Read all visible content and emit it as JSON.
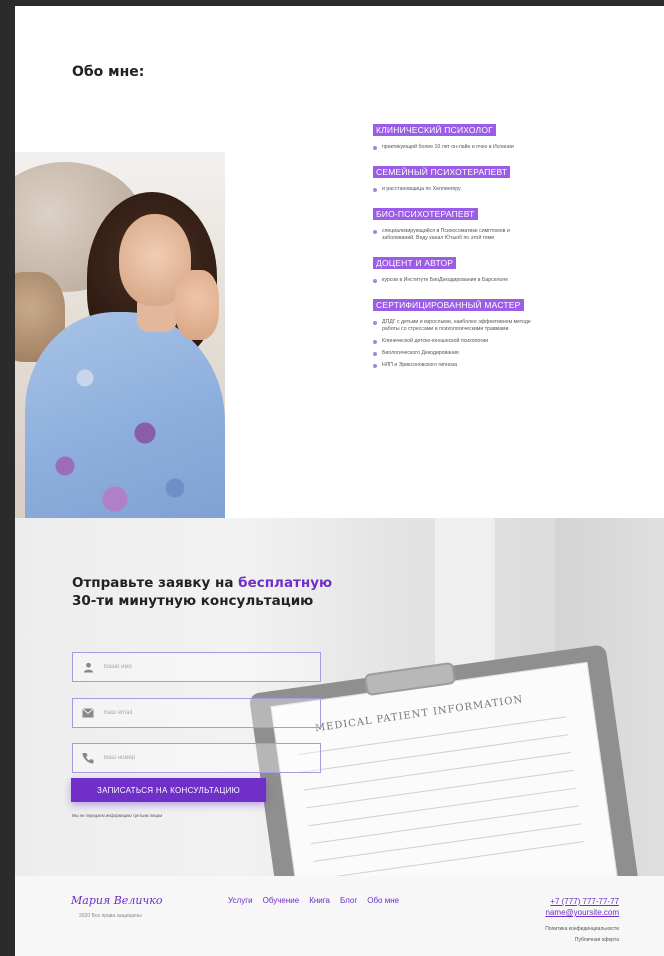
{
  "about": {
    "title": "Обо мне:",
    "roles": [
      {
        "title": "Клинический психолог",
        "items": [
          "практикующий более 10 лет он-лайн и очно в Испании"
        ]
      },
      {
        "title": "Семейный психотерапевт",
        "items": [
          "и расстановщица по Хеллингеру"
        ]
      },
      {
        "title": "Био-психотерапевт",
        "items": [
          "специализирующийся в Психосоматике симптомов и заболеваний. Веду канал Ютьюб по этой теме"
        ]
      },
      {
        "title": "Доцент и автор",
        "items": [
          "курсов в Институте БиоДекодирования в Барселоне"
        ]
      },
      {
        "title": "Сертифицированный мастер",
        "items": [
          "ДПДГ с детьми и взрослыми, наиболее эффективном методе работы со стрессами и психологическими травмами",
          "Клинической детско-юношеской психологии",
          "Биологического Декодирования",
          "НЛП и Эриксоновского гипноза"
        ]
      }
    ]
  },
  "consult": {
    "title_part1": "Отправьте заявку на ",
    "title_highlight": "бесплатную",
    "title_line2": "30-ти минутную консультацию",
    "fields": {
      "name_placeholder": "Ваше имя",
      "email_placeholder": "Ваш email",
      "phone_placeholder": "Ваш номер"
    },
    "paper_title": "MEDICAL PATIENT INFORMATION",
    "submit_label": "Записаться на консультацию",
    "disclaimer": "Мы не передаем информацию третьим лицам"
  },
  "footer": {
    "logo": "Мария Величко",
    "copyright": "2020 Все права защищены",
    "nav": [
      "Услуги",
      "Обучение",
      "Книга",
      "Блог",
      "Обо мне"
    ],
    "phone": "+7 (777) 777-77-77",
    "email": "name@yoursite.com",
    "privacy": "Политика конфиденциальности",
    "offer": "Публичная оферта"
  },
  "colors": {
    "accent": "#6f2fc8",
    "role_bg": "#9b5de5",
    "bullet": "#9b8fd6"
  }
}
